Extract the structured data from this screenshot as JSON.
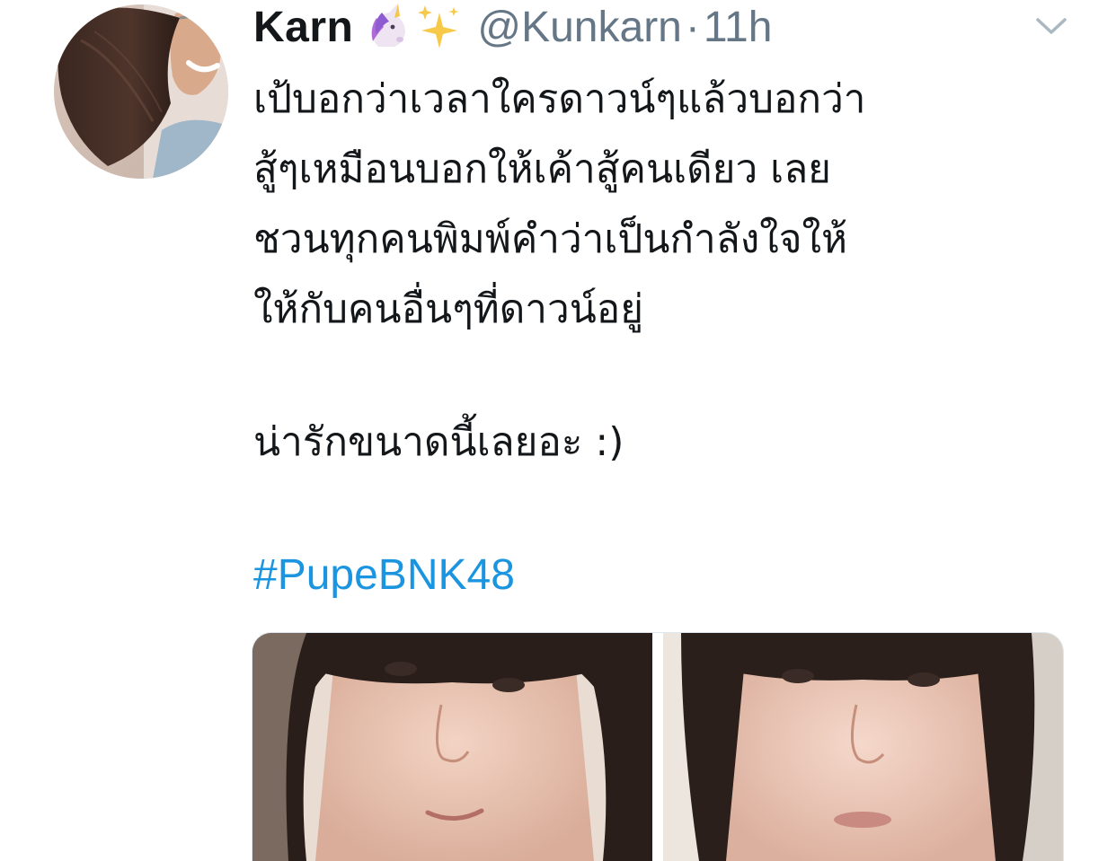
{
  "tweet": {
    "author": {
      "display_name": "Karn",
      "emoji": [
        "unicorn-emoji",
        "sparkles-emoji"
      ],
      "handle": "@Kunkarn",
      "separator": "·",
      "time": "11h"
    },
    "menu_icon": "chevron-down-icon",
    "text_lines": [
      "เป้บอกว่าเวลาใครดาวน์ๆแล้วบอกว่า",
      "สู้ๆเหมือนบอกให้เค้าสู้คนเดียว เลย",
      "ชวนทุกคนพิมพ์คำว่าเป็นกำลังใจให้",
      "ให้กับคนอื่นๆที่ดาวน์อยู่"
    ],
    "text_line_2": "น่ารักขนาดนี้เลยอะ :)",
    "hashtag": "#PupeBNK48",
    "media": {
      "count": 2,
      "items": [
        "photo-1",
        "photo-2"
      ]
    }
  },
  "colors": {
    "text": "#14171a",
    "secondary": "#657786",
    "link": "#1b95e0",
    "border": "#e1e8ed"
  }
}
